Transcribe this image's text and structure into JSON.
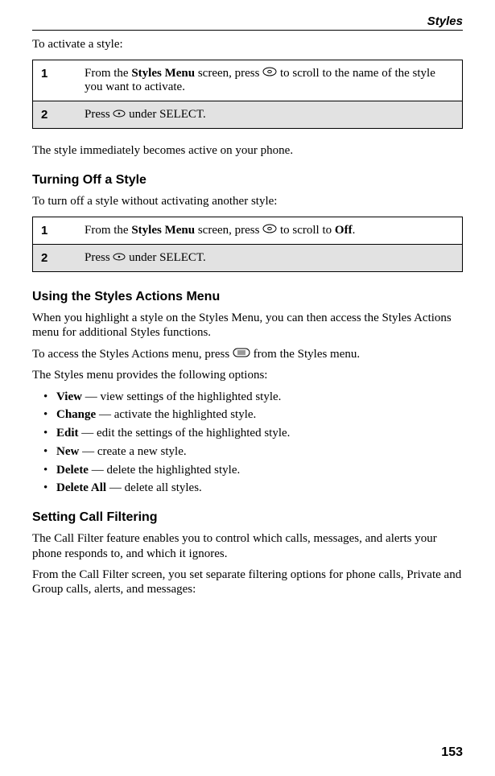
{
  "header": {
    "running_title": "Styles"
  },
  "intro1": "To activate a style:",
  "table1": {
    "r1num": "1",
    "r1_a": "From the ",
    "r1_b": "Styles Menu",
    "r1_c": " screen, press ",
    "r1_d": " to scroll to the name of the style you want to activate.",
    "r2num": "2",
    "r2_a": "Press ",
    "r2_b": " under SELECT."
  },
  "after_table1": "The style immediately becomes active on your phone.",
  "section1": "Turning Off a Style",
  "section1_intro": "To turn off a style without activating another style:",
  "table2": {
    "r1num": "1",
    "r1_a": "From the ",
    "r1_b": "Styles Menu",
    "r1_c": " screen, press ",
    "r1_d": " to scroll to ",
    "r1_e": "Off",
    "r1_f": ".",
    "r2num": "2",
    "r2_a": "Press ",
    "r2_b": " under SELECT."
  },
  "section2": "Using the Styles Actions Menu",
  "section2_p1": "When you highlight a style on the Styles Menu, you can then access the Styles Actions menu for additional Styles functions.",
  "section2_p2a": "To access the Styles Actions menu, press ",
  "section2_p2b": " from the Styles menu.",
  "section2_p3": "The Styles menu provides the following options:",
  "options": [
    {
      "term": "View",
      "desc": " — view settings of the highlighted style."
    },
    {
      "term": "Change",
      "desc": " — activate the highlighted style."
    },
    {
      "term": "Edit",
      "desc": " — edit the settings of the highlighted style."
    },
    {
      "term": "New",
      "desc": " — create a new style."
    },
    {
      "term": "Delete",
      "desc": " — delete the highlighted style."
    },
    {
      "term": "Delete All",
      "desc": " — delete all styles."
    }
  ],
  "section3": "Setting Call Filtering",
  "section3_p1": "The Call Filter feature enables you to control which calls, messages, and alerts your phone responds to, and which it ignores.",
  "section3_p2": "From the Call Filter screen, you set separate filtering options for phone calls, Private and Group calls, alerts, and messages:",
  "page_number": "153"
}
